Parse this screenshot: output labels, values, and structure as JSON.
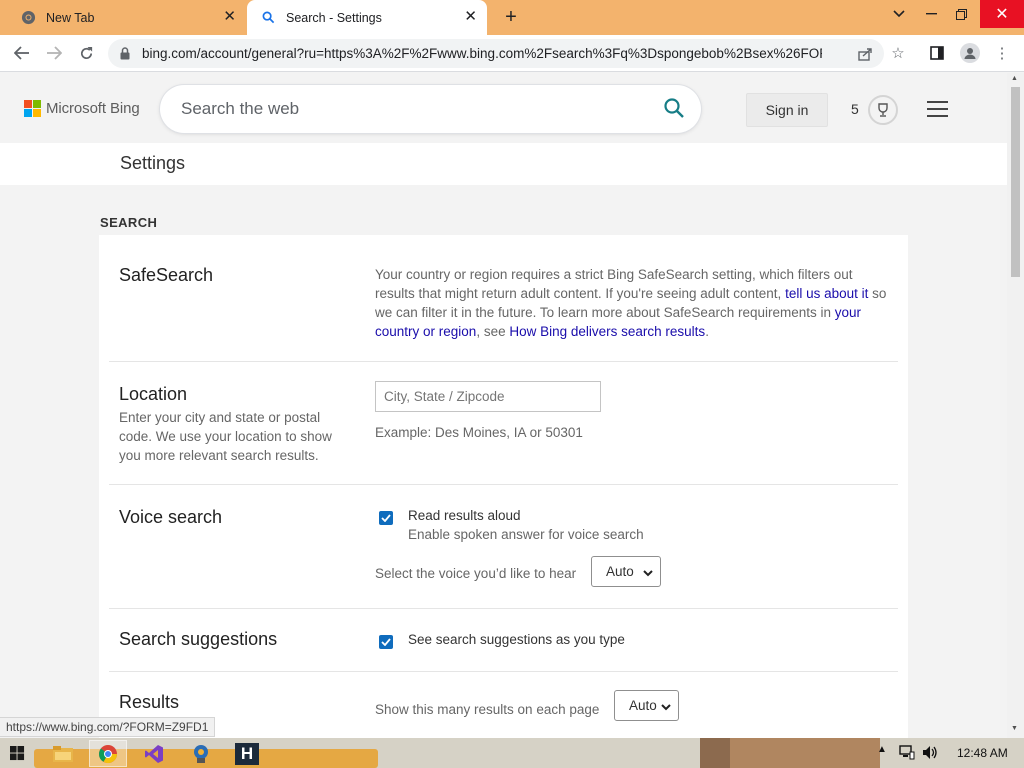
{
  "browser": {
    "tabs": [
      {
        "label": "New Tab",
        "icon": "chrome-icon"
      },
      {
        "label": "Search - Settings",
        "icon": "bing-search-icon",
        "active": true
      }
    ],
    "new_tab": "+",
    "url": "bing.com/account/general?ru=https%3A%2F%2Fwww.bing.com%2Fsearch%3Fq%3Dspongebob%2Bsex%26FOR..."
  },
  "header": {
    "brand": "Microsoft Bing",
    "search_placeholder": "Search the web",
    "sign_in": "Sign in",
    "rewards_count": "5"
  },
  "settings_title": "Settings",
  "section_title": "SEARCH",
  "safesearch": {
    "title": "SafeSearch",
    "text_1": "Your country or region requires a strict Bing SafeSearch setting, which filters out results that might return adult content. If you're seeing adult content, ",
    "link_1": "tell us about it",
    "text_2": " so we can filter it in the future. To learn more about SafeSearch requirements in ",
    "link_2": "your country or region",
    "text_3": ", see ",
    "link_3": "How Bing delivers search results",
    "text_4": "."
  },
  "location": {
    "title": "Location",
    "description": "Enter your city and state or postal code. We use your location to show you more relevant search results.",
    "placeholder": "City, State / Zipcode",
    "example": "Example: Des Moines, IA or 50301"
  },
  "voice": {
    "title": "Voice search",
    "checkbox_label": "Read results aloud",
    "checkbox_sub": "Enable spoken answer for voice search",
    "checked": true,
    "select_label": "Select the voice you’d like to hear",
    "select_value": "Auto"
  },
  "suggestions": {
    "title": "Search suggestions",
    "checkbox_label": "See search suggestions as you type",
    "checked": true
  },
  "results": {
    "title": "Results",
    "select_label": "Show this many results on each page",
    "select_value": "Auto"
  },
  "status_url": "https://www.bing.com/?FORM=Z9FD1",
  "taskbar": {
    "clock": "12:48 AM"
  },
  "colors": {
    "tabstrip": "#f3b36d",
    "link": "#1a0dab",
    "checkbox": "#0f6cbd",
    "search_icon": "#167d86"
  }
}
